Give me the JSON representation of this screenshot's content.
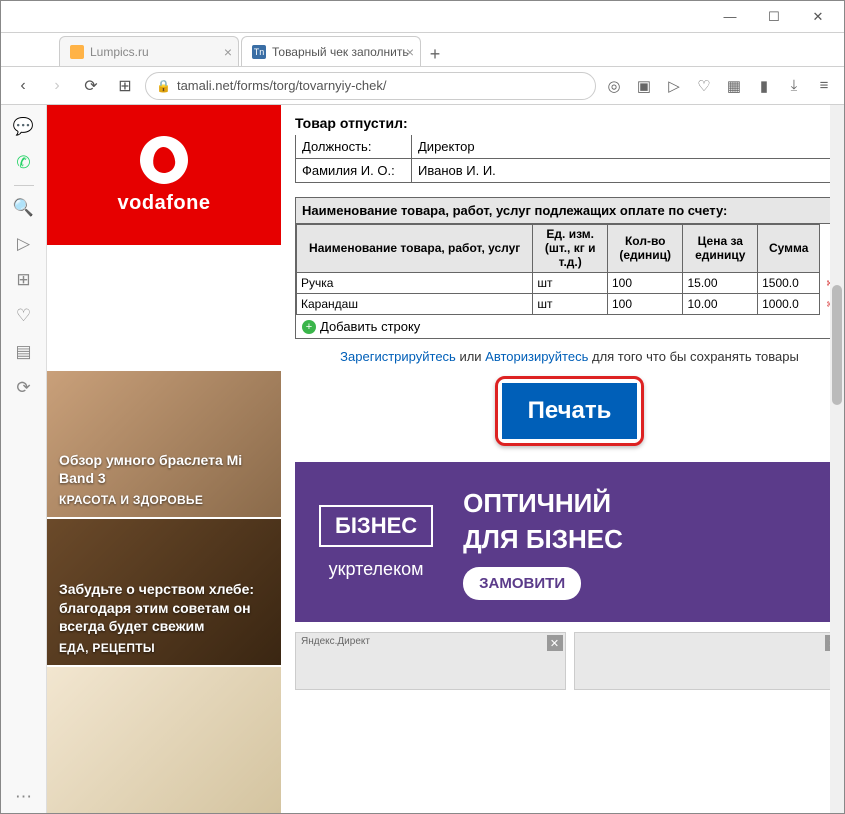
{
  "window": {
    "minimize": "—",
    "maximize": "☐",
    "close": "✕"
  },
  "tabs": [
    {
      "title": "Lumpics.ru",
      "active": false
    },
    {
      "title": "Товарный чек заполнить",
      "active": true
    }
  ],
  "newtab": "+",
  "addr": {
    "back": "‹",
    "forward": "›",
    "reload": "⟳",
    "speed": "⊞",
    "url": "tamali.net/forms/torg/tovarnyiy-chek/",
    "icons": {
      "camera": "◎",
      "vpn": "▣",
      "send": "▷",
      "heart": "♡",
      "ext1": "▦",
      "ext2": "▮",
      "download": "⤓",
      "menu": "≡"
    }
  },
  "sidebar": {
    "messenger": "💬",
    "whatsapp": "✆",
    "search": "🔍",
    "send": "▷",
    "apps": "⊞",
    "heart": "♡",
    "news": "▤",
    "history": "⟳",
    "more": "⋯"
  },
  "left": {
    "vodafone": "vodafone",
    "articles": [
      {
        "title": "Обзор умного браслета Mi Band 3",
        "cat": "КРАСОТА И ЗДОРОВЬЕ"
      },
      {
        "title": "Забудьте о черством хлебе: благодаря этим советам он всегда будет свежим",
        "cat": "ЕДА, РЕЦЕПТЫ"
      },
      {
        "title": "",
        "cat": ""
      }
    ]
  },
  "form": {
    "released_title": "Товар отпустил:",
    "position_label": "Должность:",
    "position_value": "Директор",
    "name_label": "Фамилия И. О.:",
    "name_value": "Иванов И. И.",
    "table_title": "Наименование товара, работ, услуг подлежащих оплате по счету:",
    "cols": {
      "name": "Наименование товара, работ, услуг",
      "unit": "Ед. изм. (шт., кг и т.д.)",
      "qty": "Кол-во (единиц)",
      "price": "Цена за единицу",
      "sum": "Сумма"
    },
    "rows": [
      {
        "name": "Ручка",
        "unit": "шт",
        "qty": "100",
        "price": "15.00",
        "sum": "1500.0"
      },
      {
        "name": "Карандаш",
        "unit": "шт",
        "qty": "100",
        "price": "10.00",
        "sum": "1000.0"
      }
    ],
    "add_row": "Добавить строку",
    "reg_link": "Зарегистрируйтесь",
    "reg_or": " или ",
    "auth_link": "Авторизируйтесь",
    "reg_tail": " для того что бы сохранять товары",
    "print": "Печать"
  },
  "banner": {
    "biz": "БІЗНЕС",
    "ukrt": "укртелеком",
    "line1": "ОПТИЧНИЙ",
    "line2": "ДЛЯ БІЗНЕС",
    "cta": "ЗАМОВИТИ"
  },
  "ads": {
    "label": "Яндекс.Директ",
    "close": "✕"
  }
}
